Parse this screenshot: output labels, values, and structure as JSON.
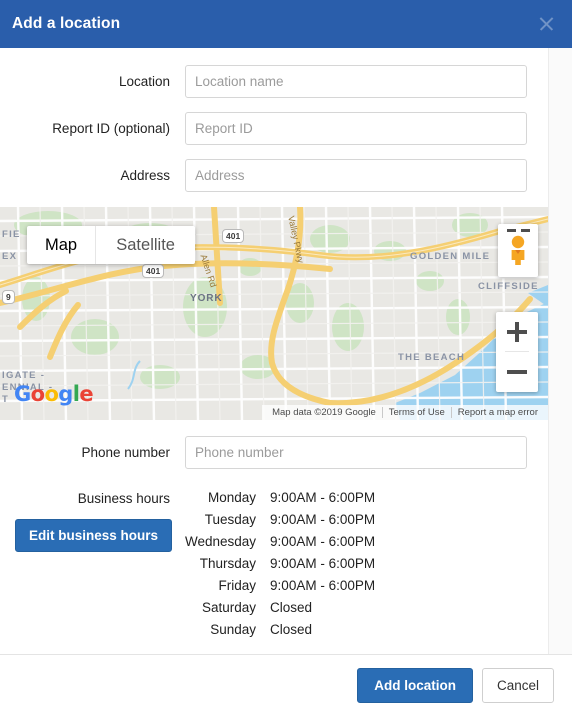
{
  "header": {
    "title": "Add a location",
    "close_icon": "close-icon"
  },
  "form": {
    "fields": [
      {
        "label": "Location",
        "placeholder": "Location name",
        "value": ""
      },
      {
        "label": "Report ID (optional)",
        "placeholder": "Report ID",
        "value": ""
      },
      {
        "label": "Address",
        "placeholder": "Address",
        "value": ""
      }
    ],
    "phone": {
      "label": "Phone number",
      "placeholder": "Phone number",
      "value": ""
    }
  },
  "map": {
    "type_buttons": [
      {
        "label": "Map",
        "active": true
      },
      {
        "label": "Satellite",
        "active": false
      }
    ],
    "pegman_icon": "street-view-pegman-icon",
    "zoom_in_label": "+",
    "zoom_out_label": "−",
    "logo": "Google",
    "logo_letters": [
      "G",
      "o",
      "o",
      "g",
      "l",
      "e"
    ],
    "attribution": [
      "Map data ©2019 Google",
      "Terms of Use",
      "Report a map error"
    ],
    "place_labels": [
      "GOLDEN MILE",
      "CLIFFSIDE",
      "THE BEACH",
      "YORK"
    ],
    "edge_labels": [
      "FIE",
      "EX",
      "IGATE -",
      "ENNIAL -",
      "T"
    ],
    "road_shields": [
      "401",
      "401",
      "9"
    ],
    "road_names": [
      "Allen Rd",
      "Valley Pkwy"
    ],
    "colors": {
      "land": "#e9e8e4",
      "water": "#9ed2f0",
      "park": "#cfe4c5",
      "highway": "#f5cf72",
      "road": "#ffffff"
    }
  },
  "business_hours": {
    "label": "Business hours",
    "edit_button": "Edit business hours",
    "rows": [
      {
        "day": "Monday",
        "hours": "9:00AM - 6:00PM"
      },
      {
        "day": "Tuesday",
        "hours": "9:00AM - 6:00PM"
      },
      {
        "day": "Wednesday",
        "hours": "9:00AM - 6:00PM"
      },
      {
        "day": "Thursday",
        "hours": "9:00AM - 6:00PM"
      },
      {
        "day": "Friday",
        "hours": "9:00AM - 6:00PM"
      },
      {
        "day": "Saturday",
        "hours": "Closed"
      },
      {
        "day": "Sunday",
        "hours": "Closed"
      }
    ]
  },
  "footer": {
    "primary": "Add location",
    "secondary": "Cancel"
  },
  "theme": {
    "header_blue": "#2a5eab",
    "button_blue": "#2a6db5"
  }
}
